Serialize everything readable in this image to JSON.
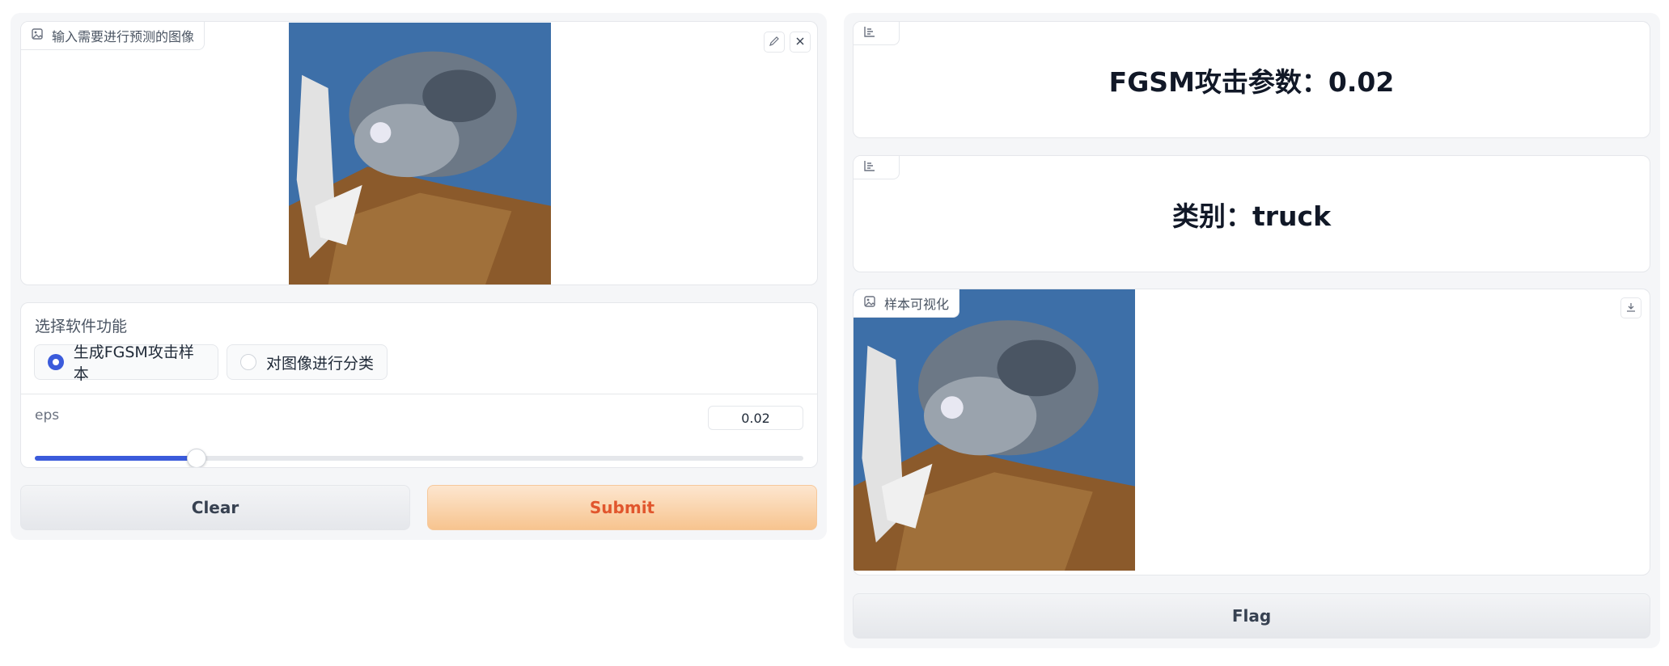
{
  "input": {
    "image_label": "输入需要进行预测的图像",
    "image_icon": "image-icon",
    "edit_icon": "pencil-icon",
    "close_icon": "close-icon"
  },
  "function_select": {
    "label": "选择软件功能",
    "options": [
      {
        "label": "生成FGSM攻击样本",
        "selected": true
      },
      {
        "label": "对图像进行分类",
        "selected": false
      }
    ]
  },
  "eps": {
    "label": "eps",
    "value": "0.02",
    "slider_fraction": 0.21,
    "accent": "#3b5bdb"
  },
  "actions": {
    "clear_label": "Clear",
    "submit_label": "Submit",
    "flag_label": "Flag"
  },
  "outputs": {
    "attack_param_text": "FGSM攻击参数：0.02",
    "class_text": "类别：truck",
    "label_icon": "bar-chart-icon",
    "vis_label": "样本可视化",
    "download_icon": "download-icon"
  }
}
